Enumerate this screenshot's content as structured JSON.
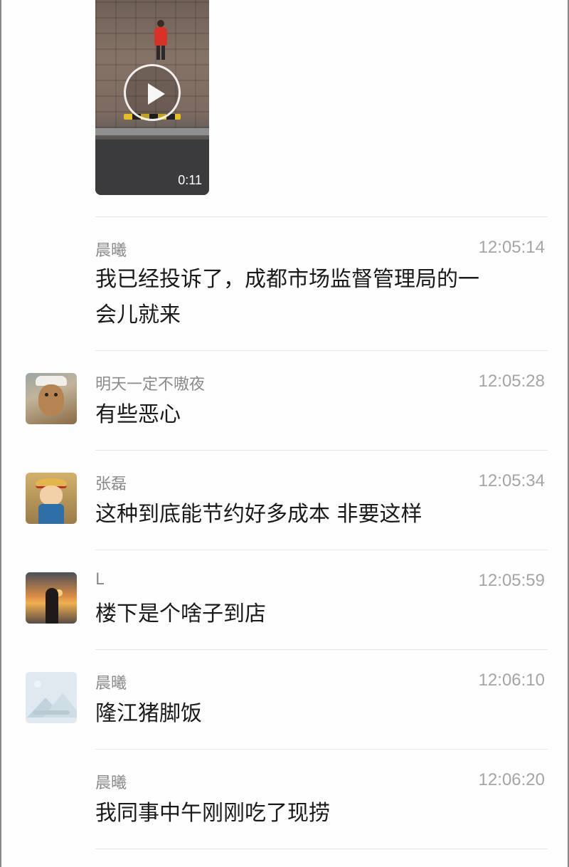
{
  "video": {
    "duration": "0:11",
    "play_icon": "play-icon"
  },
  "messages": [
    {
      "name": "晨曦",
      "time": "12:05:14",
      "text_lines": [
        "我已经投诉了，成都市场监督管理局的一",
        "会儿就来"
      ],
      "avatar": "none"
    },
    {
      "name": "明天一定不嗷夜",
      "time": "12:05:28",
      "text_lines": [
        "有些恶心"
      ],
      "avatar": "monkey-avatar"
    },
    {
      "name": "张磊",
      "time": "12:05:34",
      "text_lines": [
        "这种到底能节约好多成本 非要这样"
      ],
      "avatar": "cartoon-boy-avatar"
    },
    {
      "name": "L",
      "time": "12:05:59",
      "text_lines": [
        "楼下是个啥子到店"
      ],
      "avatar": "sunset-silhouette-avatar"
    },
    {
      "name": "晨曦",
      "time": "12:06:10",
      "text_lines": [
        "隆江猪脚饭"
      ],
      "avatar": "landscape-placeholder-avatar"
    },
    {
      "name": "晨曦",
      "time": "12:06:20",
      "text_lines": [
        "我同事中午刚刚吃了现捞"
      ],
      "avatar": "none"
    }
  ]
}
